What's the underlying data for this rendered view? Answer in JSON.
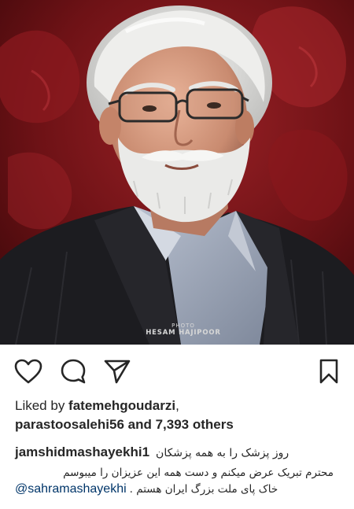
{
  "photo": {
    "watermark_line1": "PHOTO",
    "watermark_line2": "HESAM HAJIPOOR",
    "background_color": "#7a1a1d",
    "accent_color": "#b3262b"
  },
  "actions": {
    "like_icon": "heart-icon",
    "comment_icon": "comment-bubble-icon",
    "share_icon": "paper-plane-icon",
    "save_icon": "bookmark-icon"
  },
  "likes": {
    "prefix": "Liked by ",
    "first_user": "fatemehgoudarzi",
    "separator": ",",
    "second_user": "parastoosalehi56",
    "and_text": " and ",
    "others_text": "7,393 others"
  },
  "caption": {
    "author": "jamshidmashayekhi1",
    "line1": "روز پزشک را به همه پزشکان",
    "line2": "محترم تبریک عرض میکنم و دست همه این عزیزان را میبوسم",
    "mention": "@sahramashayekhi",
    "line3": "خاک پای ملت بزرگ ایران هستم .",
    "line4": "... ..."
  }
}
